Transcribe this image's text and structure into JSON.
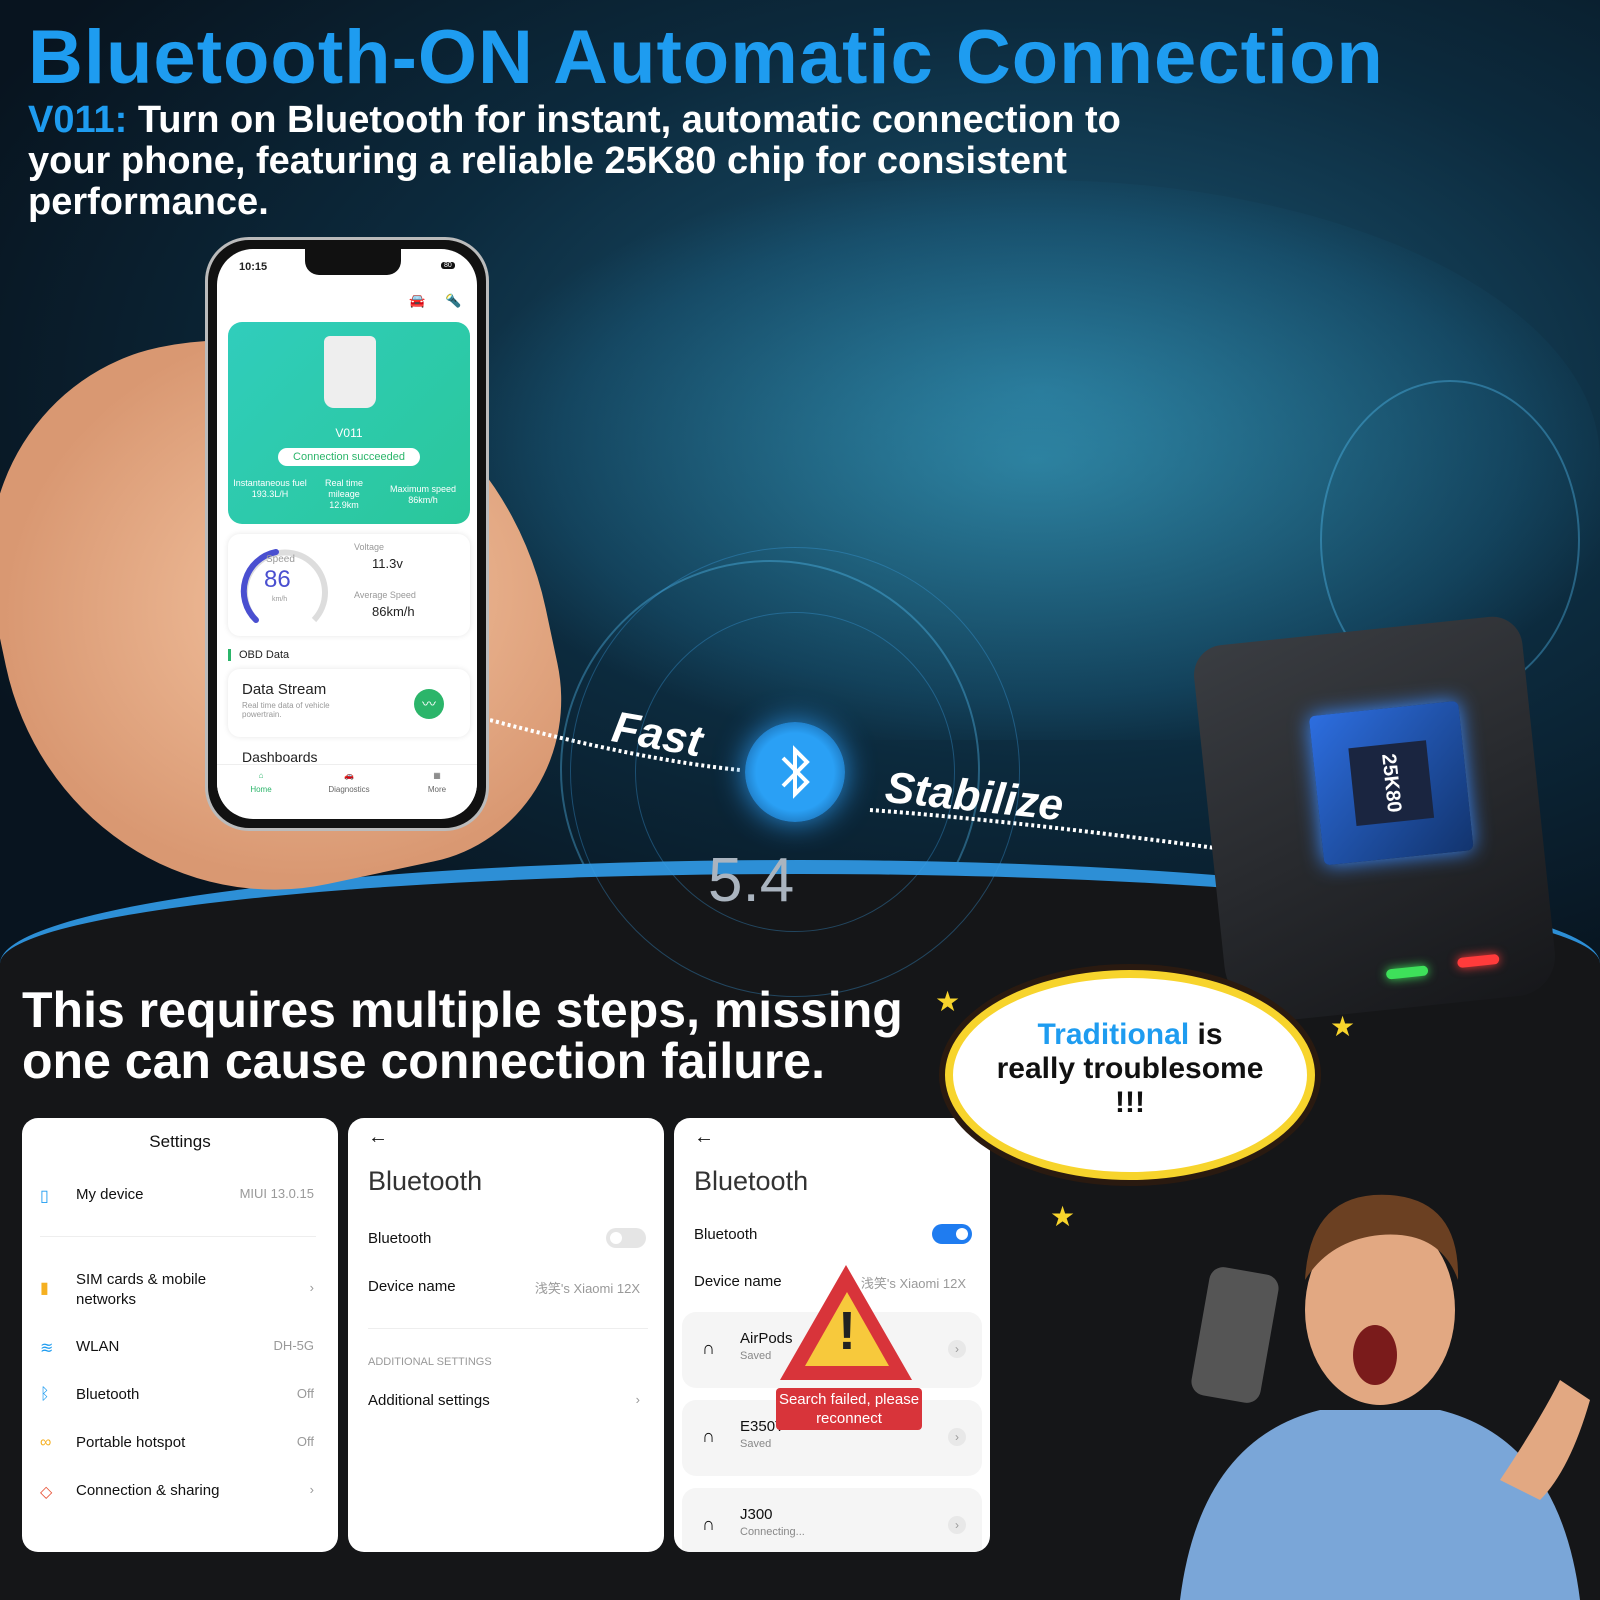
{
  "header": {
    "title": "Bluetooth-ON Automatic Connection",
    "subtitle_highlight": "V011:",
    "subtitle": "Turn on Bluetooth for instant, automatic connection to your phone, featuring a reliable 25K80 chip for consistent performance."
  },
  "phone": {
    "time": "10:15",
    "battery": "80",
    "device_name": "V011",
    "status": "Connection succeeded",
    "stats": [
      {
        "label": "Instantaneous fuel",
        "value": "193.3L/H"
      },
      {
        "label": "Real time mileage",
        "value": "12.9km"
      },
      {
        "label": "Maximum speed",
        "value": "86km/h"
      }
    ],
    "gauge": {
      "label": "Speed",
      "value": "86",
      "unit": "km/h",
      "fraction": 0.45
    },
    "voltage": {
      "label": "Voltage",
      "value": "11.3v"
    },
    "avg_speed": {
      "label": "Average Speed",
      "value": "86km/h"
    },
    "section": "OBD Data",
    "data_stream": {
      "title": "Data Stream",
      "desc": "Real time data of vehicle powertrain."
    },
    "dashboards": "Dashboards",
    "nav": [
      "Home",
      "Diagnostics",
      "More"
    ],
    "accent": "#2bb56a"
  },
  "center": {
    "fast": "Fast",
    "stabilize": "Stabilize",
    "version": "5.4",
    "chip": "25K80"
  },
  "requirement": "This requires multiple steps, missing one can cause connection failure.",
  "panels": {
    "settings": {
      "title": "Settings",
      "items": [
        {
          "icon": "phone-icon",
          "label": "My device",
          "value": "MIUI 13.0.15"
        },
        {
          "icon": "sim-icon",
          "label": "SIM cards & mobile networks",
          "value": ""
        },
        {
          "icon": "wifi-icon",
          "label": "WLAN",
          "value": "DH-5G"
        },
        {
          "icon": "bluetooth-icon",
          "label": "Bluetooth",
          "value": "Off"
        },
        {
          "icon": "hotspot-icon",
          "label": "Portable hotspot",
          "value": "Off"
        },
        {
          "icon": "share-icon",
          "label": "Connection & sharing",
          "value": ""
        }
      ]
    },
    "bt_off": {
      "title": "Bluetooth",
      "toggle_label": "Bluetooth",
      "toggle_on": false,
      "device_label": "Device name",
      "device_value": "浅笑's Xiaomi 12X",
      "section": "ADDITIONAL SETTINGS",
      "additional": "Additional settings"
    },
    "bt_on": {
      "title": "Bluetooth",
      "toggle_label": "Bluetooth",
      "toggle_on": true,
      "device_label": "Device name",
      "device_value": "浅笑's Xiaomi 12X",
      "devices": [
        {
          "name": "AirPods",
          "status": "Saved"
        },
        {
          "name": "E350T",
          "status": "Saved"
        },
        {
          "name": "J300",
          "status": "Connecting..."
        }
      ],
      "warning": "Search failed, please reconnect"
    }
  },
  "bubble": {
    "highlight": "Traditional",
    "line1_rest": "is",
    "line2": "really troublesome",
    "line3": "!!!"
  },
  "colors": {
    "brand": "#1e9cf0",
    "warning": "#d8343a",
    "toggle_on": "#1f7cf0"
  }
}
